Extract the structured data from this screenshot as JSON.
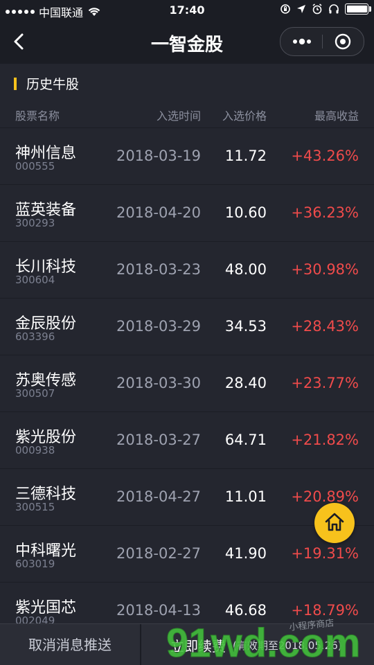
{
  "status_bar": {
    "carrier": "中国联通",
    "time": "17:40"
  },
  "nav": {
    "title": "一智金股"
  },
  "section": {
    "title": "历史牛股"
  },
  "table": {
    "headers": {
      "name": "股票名称",
      "time": "入选时间",
      "price": "入选价格",
      "gain": "最高收益"
    },
    "rows": [
      {
        "name": "神州信息",
        "code": "000555",
        "date": "2018-03-19",
        "price": "11.72",
        "gain": "+43.26%"
      },
      {
        "name": "蓝英装备",
        "code": "300293",
        "date": "2018-04-20",
        "price": "10.60",
        "gain": "+36.23%"
      },
      {
        "name": "长川科技",
        "code": "300604",
        "date": "2018-03-23",
        "price": "48.00",
        "gain": "+30.98%"
      },
      {
        "name": "金辰股份",
        "code": "603396",
        "date": "2018-03-29",
        "price": "34.53",
        "gain": "+28.43%"
      },
      {
        "name": "苏奥传感",
        "code": "300507",
        "date": "2018-03-30",
        "price": "28.40",
        "gain": "+23.77%"
      },
      {
        "name": "紫光股份",
        "code": "000938",
        "date": "2018-03-27",
        "price": "64.71",
        "gain": "+21.82%"
      },
      {
        "name": "三德科技",
        "code": "300515",
        "date": "2018-04-27",
        "price": "11.01",
        "gain": "+20.89%"
      },
      {
        "name": "中科曙光",
        "code": "603019",
        "date": "2018-02-27",
        "price": "41.90",
        "gain": "+19.31%"
      },
      {
        "name": "紫光国芯",
        "code": "002049",
        "date": "2018-04-13",
        "price": "46.68",
        "gain": "+18.79%"
      }
    ]
  },
  "bottom": {
    "cancel_label": "取消消息推送",
    "renew_label": "立即续费",
    "expiry_text": "(有效期至2018.05.26)"
  },
  "watermark": {
    "text": "91wd.com",
    "subtext": "小程序商店"
  },
  "colors": {
    "background": "#24262f",
    "accent_yellow": "#f7c21c",
    "gain_red": "#f04b4b",
    "muted_text": "#8b8f9e",
    "watermark_green": "#43c23c"
  }
}
